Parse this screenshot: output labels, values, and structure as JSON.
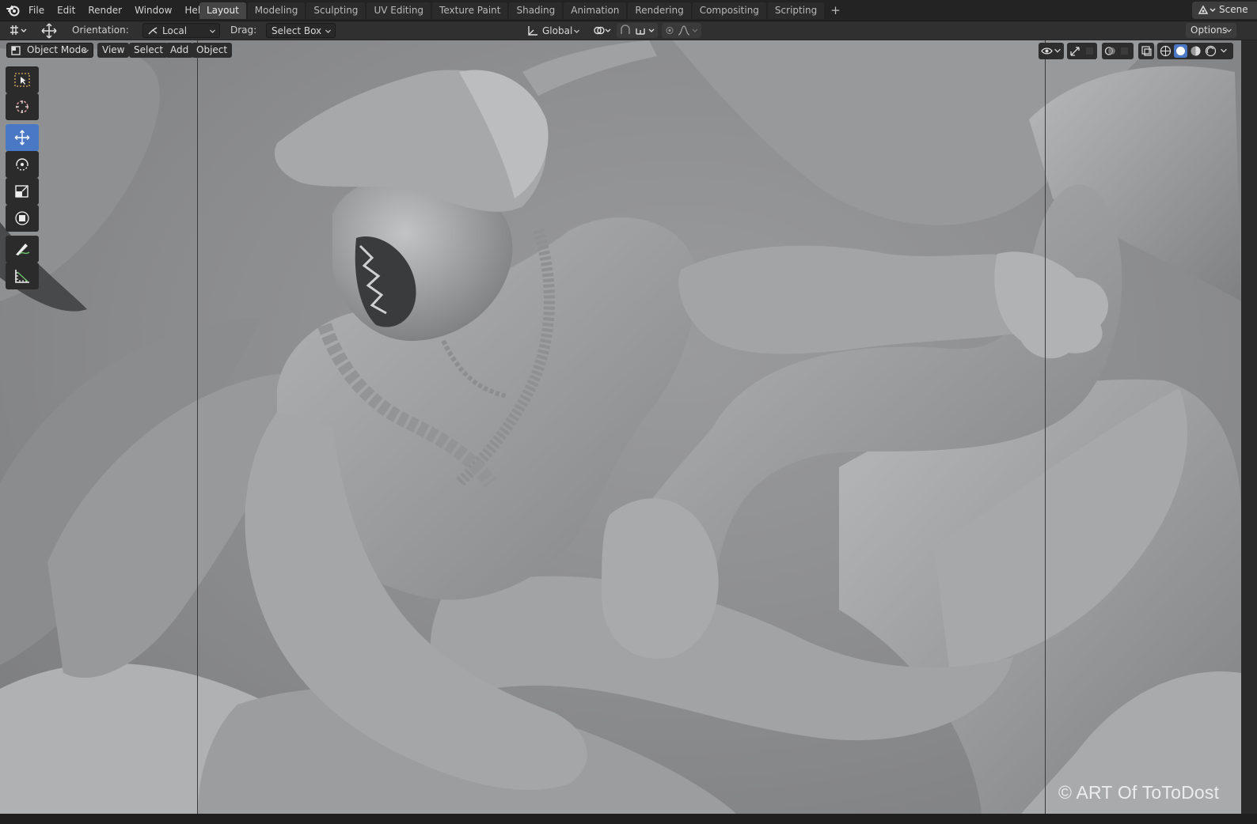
{
  "menu": [
    "File",
    "Edit",
    "Render",
    "Window",
    "Help"
  ],
  "workspace_tabs": [
    {
      "label": "Layout",
      "active": true
    },
    {
      "label": "Modeling",
      "active": false
    },
    {
      "label": "Sculpting",
      "active": false
    },
    {
      "label": "UV Editing",
      "active": false
    },
    {
      "label": "Texture Paint",
      "active": false
    },
    {
      "label": "Shading",
      "active": false
    },
    {
      "label": "Animation",
      "active": false
    },
    {
      "label": "Rendering",
      "active": false
    },
    {
      "label": "Compositing",
      "active": false
    },
    {
      "label": "Scripting",
      "active": false
    }
  ],
  "add_tab_label": "+",
  "scene_label": "Scene",
  "tool_settings": {
    "orientation_label": "Orientation:",
    "orientation_value": "Local",
    "drag_label": "Drag:",
    "drag_value": "Select Box",
    "transform_orientation": "Global",
    "options_label": "Options"
  },
  "viewport": {
    "mode": "Object Mode",
    "menus": [
      "View",
      "Select",
      "Add",
      "Object"
    ],
    "watermark": "© ART Of  ToToDost"
  },
  "toolbox": [
    {
      "name": "select-box",
      "icon": "select-box-icon",
      "active": false
    },
    {
      "name": "cursor",
      "icon": "cursor-icon",
      "active": false
    },
    {
      "name": "move",
      "icon": "move-icon",
      "active": true
    },
    {
      "name": "rotate",
      "icon": "rotate-icon",
      "active": false
    },
    {
      "name": "scale",
      "icon": "scale-icon",
      "active": false
    },
    {
      "name": "transform",
      "icon": "transform-icon",
      "active": false
    },
    {
      "name": "annotate",
      "icon": "annotate-icon",
      "active": false
    },
    {
      "name": "measure",
      "icon": "measure-icon",
      "active": false
    }
  ],
  "colors": {
    "accent_active": "#4b78c4",
    "topbar": "#232323",
    "header": "#303030",
    "viewport_clay": "#9a9b9d"
  }
}
